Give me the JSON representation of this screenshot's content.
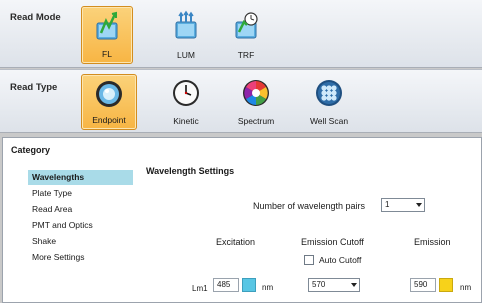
{
  "read_mode": {
    "title": "Read Mode",
    "options": [
      {
        "label": "FL",
        "icon": "fl-icon",
        "selected": true
      },
      {
        "label": "LUM",
        "icon": "lum-icon",
        "selected": false
      },
      {
        "label": "TRF",
        "icon": "trf-icon",
        "selected": false
      }
    ]
  },
  "read_type": {
    "title": "Read Type",
    "options": [
      {
        "label": "Endpoint",
        "icon": "endpoint-icon",
        "selected": true
      },
      {
        "label": "Kinetic",
        "icon": "clock-icon",
        "selected": false
      },
      {
        "label": "Spectrum",
        "icon": "spectrum-icon",
        "selected": false
      },
      {
        "label": "Well Scan",
        "icon": "well-scan-icon",
        "selected": false
      }
    ]
  },
  "category": {
    "title": "Category",
    "items": [
      "Wavelengths",
      "Plate Type",
      "Read Area",
      "PMT and Optics",
      "Shake",
      "More Settings"
    ],
    "active_index": 0
  },
  "wavelength_settings": {
    "title": "Wavelength Settings",
    "pairs_label": "Number of wavelength pairs",
    "pairs_value": "1",
    "columns": {
      "excitation": "Excitation",
      "emission_cutoff": "Emission Cutoff",
      "emission": "Emission"
    },
    "auto_cutoff_label": "Auto Cutoff",
    "auto_cutoff_checked": false,
    "row": {
      "label": "Lm1",
      "excitation": "485",
      "excitation_unit": "nm",
      "excitation_color": "#58c6e4",
      "emission_cutoff": "570",
      "emission": "590",
      "emission_unit": "nm",
      "emission_color": "#f7d21a"
    }
  },
  "colors": {
    "selected_tile": "#f7b544",
    "active_category": "#a9dbe8"
  }
}
